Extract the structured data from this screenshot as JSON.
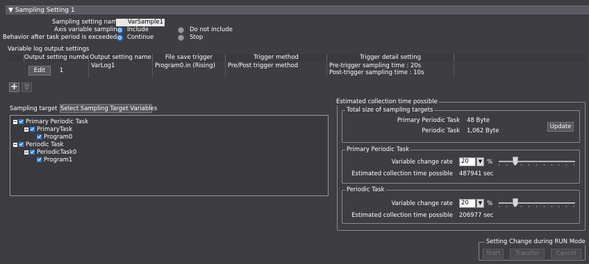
{
  "section": {
    "title": "▼ Sampling Setting 1"
  },
  "settings": {
    "name_label": "Sampling setting name",
    "name_value": "VarSample1",
    "axis_label": "Axis variable sampling",
    "axis_include": "Include",
    "axis_exclude": "Do not include",
    "behavior_label": "Behavior after task period is exceeded",
    "behavior_continue": "Continue",
    "behavior_stop": "Stop"
  },
  "log_output": {
    "title": "Variable log output settings",
    "headers": [
      "Output setting number",
      "Output setting name",
      "File save trigger",
      "Trigger method",
      "Trigger detail setting"
    ],
    "row": {
      "edit_label": "Edit",
      "number": "1",
      "name": "VarLog1",
      "file_trigger": "Program0.in (Rising)",
      "method": "Pre/Post trigger method",
      "detail_line1": "Pre-trigger sampling time : 20s",
      "detail_line2": "Post-trigger sampling time : 10s"
    }
  },
  "toolbar": {
    "add_glyph": "+",
    "delete_glyph": "🗑"
  },
  "target": {
    "label": "Sampling target",
    "select_button": "Select Sampling Target Variables",
    "tree": [
      {
        "label": "Primary Periodic Task",
        "level": 0
      },
      {
        "label": "PrimaryTask",
        "level": 1
      },
      {
        "label": "Program0",
        "level": 2
      },
      {
        "label": "Periodic Task",
        "level": 0
      },
      {
        "label": "PeriodicTask0",
        "level": 1
      },
      {
        "label": "Program1",
        "level": 2
      }
    ]
  },
  "estimate": {
    "title": "Estimated collection time possible",
    "total": {
      "title": "Total size of sampling targets",
      "primary_label": "Primary Periodic Task",
      "primary_value": "48 Byte",
      "periodic_label": "Periodic Task",
      "periodic_value": "1,062 Byte",
      "update_button": "Update"
    },
    "primary": {
      "title": "Primary Periodic Task",
      "rate_label": "Variable change rate",
      "rate_value": "20",
      "unit": "%",
      "slider_level": 0.2,
      "time_label": "Estimated collection time possible",
      "time_value": "487941 sec"
    },
    "periodic": {
      "title": "Periodic Task",
      "rate_label": "Variable change rate",
      "rate_value": "20",
      "unit": "%",
      "slider_level": 0.2,
      "time_label": "Estimated collection time possible",
      "time_value": "206977 sec"
    }
  },
  "run_mode": {
    "title": "Setting Change during RUN Mode",
    "start": "Start",
    "transfer": "Transfer",
    "cancel": "Cancel"
  },
  "colors": {
    "accent": "#2f80d8",
    "background": "#3e3e42"
  },
  "icons": {
    "add": "plus-icon",
    "delete": "trash-icon",
    "dropdown": "chevron-down-icon"
  }
}
